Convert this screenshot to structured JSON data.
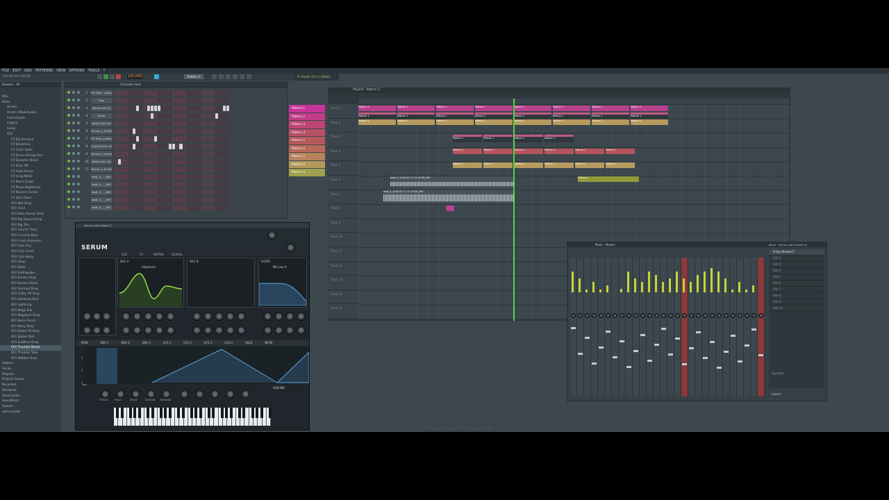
{
  "menu": {
    "items": [
      "FILE",
      "EDIT",
      "ADD",
      "PATTERNS",
      "VIEW",
      "OPTIONS",
      "TOOLS",
      "?"
    ]
  },
  "hint_bar": "1:01:00  Fex 1:00:00",
  "toolbar": {
    "tempo": "125.000",
    "pattern": "Pattern 2",
    "cpu_label": "FL Studio 12.5.1 [64bit]"
  },
  "browser": {
    "title": "Browser - All",
    "items": [
      "Misc",
      "Packs",
      "Drums",
      "Drums (ModeAudio)",
      "Instruments",
      "Legacy",
      "Loops",
      "SFX",
      "FX Big Reverse",
      "FX Blackhole",
      "FX Choir Swell",
      "FX Drone Strings Rev",
      "FX Dynamic Noise",
      "FX Echo FM",
      "FX Flute Drone",
      "FX Long Metal",
      "FX Mech Growl",
      "FX Piano Nightmare",
      "FX Reverse Series",
      "FX Spin Down",
      "SFX 8bit Drop",
      "SFX Anvil",
      "SFX Bass Sweep Drop",
      "SFX Big Square Drop",
      "SFX Big Tom",
      "SFX Church Thud",
      "SFX Crunchy Bass",
      "SFX Crush Explosion",
      "SFX Cym Airy",
      "SFX Cym Crush",
      "SFX Cym Noisy",
      "SFX Deep",
      "SFX Disto",
      "SFX Earthquake",
      "SFX Electro Drop",
      "SFX Electro Shock",
      "SFX Formant Drop",
      "SFX Gritty FM Drop",
      "SFX Hardcore Kick",
      "SFX Lightning",
      "SFX Mega Sub",
      "SFX Megatom Drop",
      "SFX Noise Punch",
      "SFX Noisy Drop",
      "SFX Radio FM Drop",
      "SFX Splash Noir",
      "SFX SubBass Drop",
      "SFX Thunder Sheet",
      "SFX Thunder Tube",
      "SFX Wobble Drop",
      "Shapes",
      "Vocals",
      "Projects",
      "Projects bones",
      "Recorded",
      "Rendered",
      "Sliced beats",
      "Soundfonts",
      "Speech",
      "splice_folder"
    ],
    "selected": "SFX Thunder Sheet"
  },
  "channel_rack": {
    "title": "Channel rack",
    "channels": [
      {
        "num": "1",
        "name": "FM Stab - hyBass"
      },
      {
        "num": "2",
        "name": "Trap"
      },
      {
        "num": "3",
        "name": "Attack Hat 15"
      },
      {
        "num": "4",
        "name": "Snare"
      },
      {
        "num": "5",
        "name": "Attack Kick 06"
      },
      {
        "num": "6",
        "name": "Serum_s_#2.Bk"
      },
      {
        "num": "7",
        "name": "FM Side_ip Bass"
      },
      {
        "num": "8",
        "name": "Fracture Pnc 16"
      },
      {
        "num": "9",
        "name": "Serum_s_sound"
      },
      {
        "num": "10",
        "name": "Attack Kick 08"
      },
      {
        "num": "11",
        "name": "Serum_s_#3.Bk"
      },
      {
        "num": "",
        "name": "beat_5_..._065"
      },
      {
        "num": "",
        "name": "beat_5_..._065"
      },
      {
        "num": "",
        "name": "beat_5_..._065"
      },
      {
        "num": "",
        "name": "beat_5_..._065"
      },
      {
        "num": "",
        "name": "beat_5_..._065"
      }
    ]
  },
  "pattern_list": [
    {
      "name": "Pattern 1",
      "color": "#c8359a"
    },
    {
      "name": "Pattern 2",
      "color": "#c23d88"
    },
    {
      "name": "Pattern 3",
      "color": "#bd4675"
    },
    {
      "name": "Pattern 4",
      "color": "#b85067"
    },
    {
      "name": "Pattern 5",
      "color": "#b7595c"
    },
    {
      "name": "Pattern 6",
      "color": "#b9695a"
    },
    {
      "name": "Pattern 7",
      "color": "#b7825b"
    },
    {
      "name": "Pattern 8",
      "color": "#b39a5c"
    },
    {
      "name": "Pattern 9",
      "color": "#9fa14c"
    }
  ],
  "playlist": {
    "title": "Playlist - Pattern 2",
    "tracks": [
      "Track 1",
      "Track 2",
      "Track 3",
      "Track 4",
      "Track 5",
      "Track 6",
      "Track 7",
      "Track 8",
      "Track 9",
      "Track 10",
      "Track 11",
      "Track 12",
      "Track 13",
      "Track 14",
      "Track 15"
    ],
    "clip_label": "Pattern 1",
    "audio_clip_1": "beat_5_2018-05-12 12-25-06_065",
    "audio_clip_2": "beat_5_2018-05-12 12-25-06_065"
  },
  "serum": {
    "title": "Serum_s#4 (Insert 1)",
    "logo": "SERUM",
    "tabs": [
      "OSC",
      "FX",
      "MATRIX",
      "GLOBAL"
    ],
    "osc_a": "OSC A",
    "osc_a_table": "Allophone",
    "osc_b": "OSC B",
    "filter": "FILTER",
    "filter_type": "MG Low 6",
    "mod_tabs": [
      "MOD",
      "ENV 1",
      "ENV 2",
      "ENV 3",
      "LFO 1",
      "LFO 2",
      "LFO 3",
      "LFO 4",
      "VELO",
      "NOTE"
    ],
    "env_labels": [
      "ATTACK",
      "HOLD",
      "DECAY",
      "SUSTAIN",
      "RELEASE"
    ],
    "voicing": "VOICING"
  },
  "mixer": {
    "title": "Mixer - Master",
    "insert_title": "Mixer - Serum_s#4 (Insert 4)",
    "slots": [
      "Fruity Reverb 2",
      "Slot 2",
      "Slot 3",
      "Slot 4",
      "Slot 5",
      "Slot 6",
      "Slot 7",
      "Slot 8",
      "Slot 9",
      "Slot 10"
    ],
    "equalizer": "Equalizer",
    "out": "(none)"
  },
  "footer": "Producer Edition v12.5.1 [64bit] (b2) - 64Bit"
}
